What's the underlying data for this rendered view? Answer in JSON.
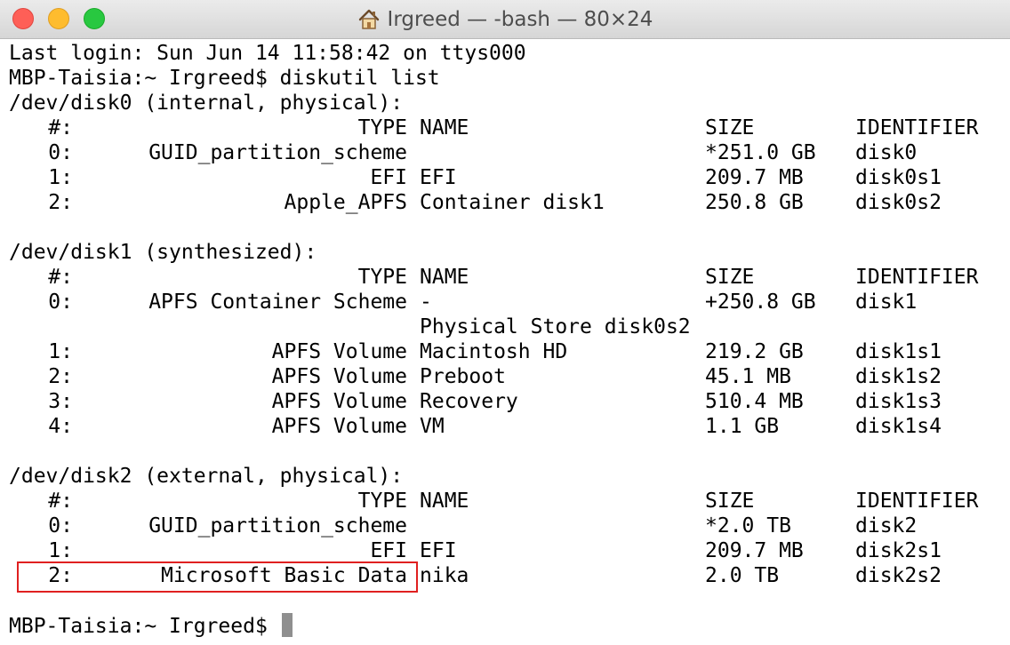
{
  "window": {
    "title": "Irgreed — -bash — 80×24",
    "title_icon": "home-icon",
    "buttons": [
      "close",
      "minimize",
      "zoom"
    ]
  },
  "terminal": {
    "last_login": "Last login: Sun Jun 14 11:58:42 on ttys000",
    "command_line": "MBP-Taisia:~ Irgreed$ diskutil list",
    "prompt": "MBP-Taisia:~ Irgreed$ ",
    "header": {
      "idx": "#:",
      "type": "TYPE",
      "name": "NAME",
      "size": "SIZE",
      "identifier": "IDENTIFIER"
    },
    "disks": [
      {
        "title": "/dev/disk0 (internal, physical):",
        "rows": [
          {
            "idx": "0:",
            "type": "GUID_partition_scheme",
            "name": "",
            "size": "*251.0 GB",
            "identifier": "disk0"
          },
          {
            "idx": "1:",
            "type": "EFI",
            "name": "EFI",
            "size": "209.7 MB",
            "identifier": "disk0s1"
          },
          {
            "idx": "2:",
            "type": "Apple_APFS",
            "name": "Container disk1",
            "size": "250.8 GB",
            "identifier": "disk0s2"
          }
        ]
      },
      {
        "title": "/dev/disk1 (synthesized):",
        "rows": [
          {
            "idx": "0:",
            "type": "APFS Container Scheme",
            "name": "-",
            "size": "+250.8 GB",
            "identifier": "disk1"
          },
          {
            "idx": "",
            "type": "",
            "name": "Physical Store disk0s2",
            "size": "",
            "identifier": ""
          },
          {
            "idx": "1:",
            "type": "APFS Volume",
            "name": "Macintosh HD",
            "size": "219.2 GB",
            "identifier": "disk1s1"
          },
          {
            "idx": "2:",
            "type": "APFS Volume",
            "name": "Preboot",
            "size": "45.1 MB",
            "identifier": "disk1s2"
          },
          {
            "idx": "3:",
            "type": "APFS Volume",
            "name": "Recovery",
            "size": "510.4 MB",
            "identifier": "disk1s3"
          },
          {
            "idx": "4:",
            "type": "APFS Volume",
            "name": "VM",
            "size": "1.1 GB",
            "identifier": "disk1s4"
          }
        ]
      },
      {
        "title": "/dev/disk2 (external, physical):",
        "rows": [
          {
            "idx": "0:",
            "type": "GUID_partition_scheme",
            "name": "",
            "size": "*2.0 TB",
            "identifier": "disk2"
          },
          {
            "idx": "1:",
            "type": "EFI",
            "name": "EFI",
            "size": "209.7 MB",
            "identifier": "disk2s1"
          },
          {
            "idx": "2:",
            "type": "Microsoft Basic Data",
            "name": "nika",
            "size": "2.0 TB",
            "identifier": "disk2s2"
          }
        ]
      }
    ]
  },
  "annotation": {
    "color": "#e02020",
    "target": "Microsoft Basic Data partition row"
  }
}
